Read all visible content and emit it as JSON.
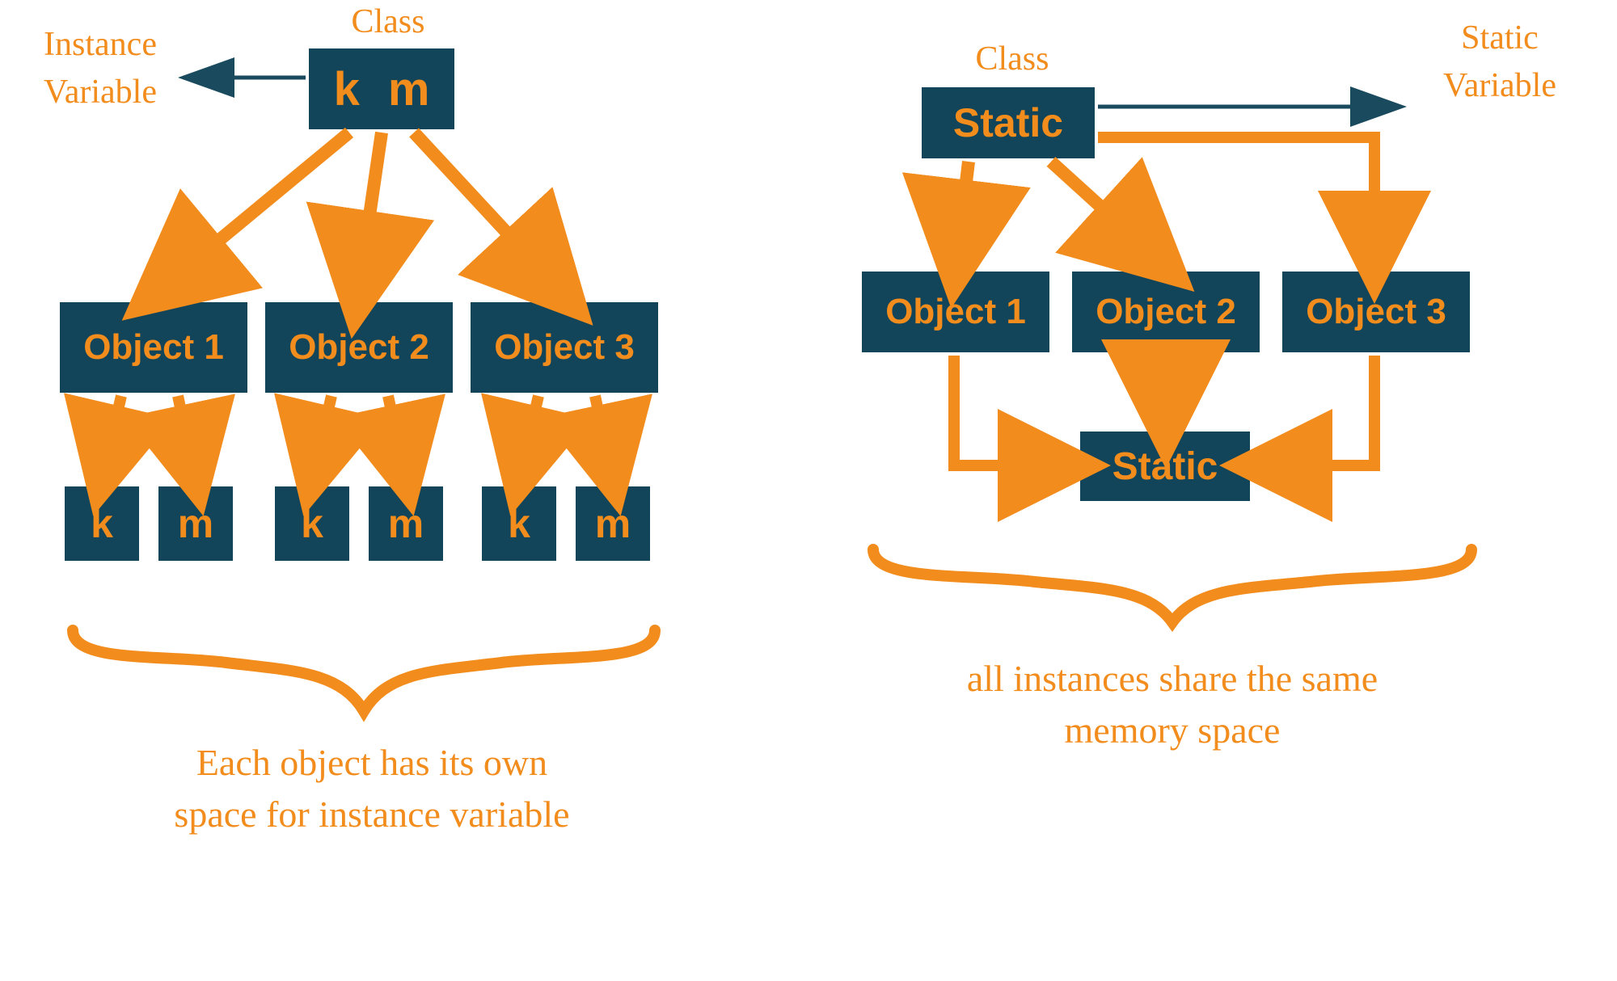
{
  "left": {
    "classLabel": "Class",
    "varLabel": "Instance\nVariable",
    "classBox": {
      "var1": "k",
      "var2": "m"
    },
    "objects": [
      "Object 1",
      "Object 2",
      "Object 3"
    ],
    "fields": [
      "k",
      "m",
      "k",
      "m",
      "k",
      "m"
    ],
    "caption": "Each object has its own\nspace for instance variable"
  },
  "right": {
    "classLabel": "Class",
    "varLabel": "Static\nVariable",
    "classBox": "Static",
    "objects": [
      "Object 1",
      "Object 2",
      "Object 3"
    ],
    "sharedBox": "Static",
    "caption": "all instances share the same\nmemory space"
  },
  "colors": {
    "box": "#124559",
    "accent": "#f28c1c",
    "arrowDark": "#1a4a5e"
  }
}
